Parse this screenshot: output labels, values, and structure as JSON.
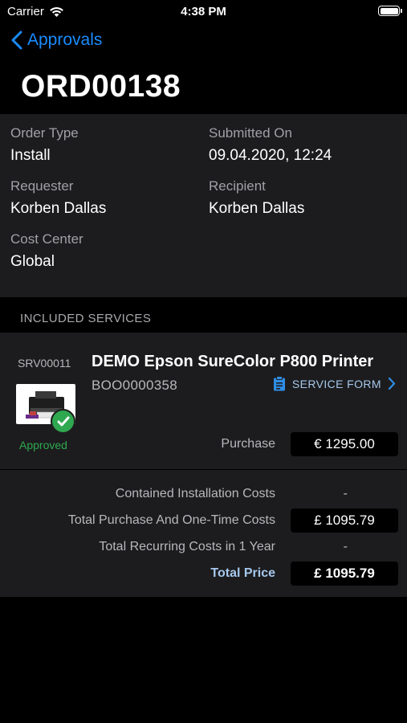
{
  "status_bar": {
    "carrier": "Carrier",
    "time": "4:38 PM"
  },
  "nav": {
    "back_label": "Approvals",
    "title": "ORD00138"
  },
  "order": {
    "order_type_label": "Order Type",
    "order_type": "Install",
    "submitted_on_label": "Submitted On",
    "submitted_on": "09.04.2020, 12:24",
    "requester_label": "Requester",
    "requester": "Korben Dallas",
    "recipient_label": "Recipient",
    "recipient": "Korben Dallas",
    "cost_center_label": "Cost Center",
    "cost_center": "Global"
  },
  "section": {
    "included_services": "INCLUDED SERVICES"
  },
  "service": {
    "id": "SRV00011",
    "name": "DEMO Epson SureColor P800 Printer",
    "code": "BOO0000358",
    "status": "Approved",
    "service_form_label": "SERVICE FORM",
    "purchase_label": "Purchase",
    "purchase_price": "€ 1295.00"
  },
  "summary": {
    "installation_label": "Contained Installation Costs",
    "installation_value": "-",
    "one_time_label": "Total Purchase And One-Time Costs",
    "one_time_value": "£ 1095.79",
    "recurring_label": "Total Recurring Costs in 1 Year",
    "recurring_value": "-",
    "total_label": "Total Price",
    "total_value": "£ 1095.79"
  },
  "colors": {
    "accent": "#1a8cff",
    "approved": "#2fa84f",
    "panel": "#1c1c1e",
    "link": "#a6c8ec"
  },
  "icons": [
    "wifi-icon",
    "battery-icon",
    "back-chevron-icon",
    "clipboard-icon",
    "chevron-right-icon",
    "checkmark-icon",
    "printer-image"
  ]
}
